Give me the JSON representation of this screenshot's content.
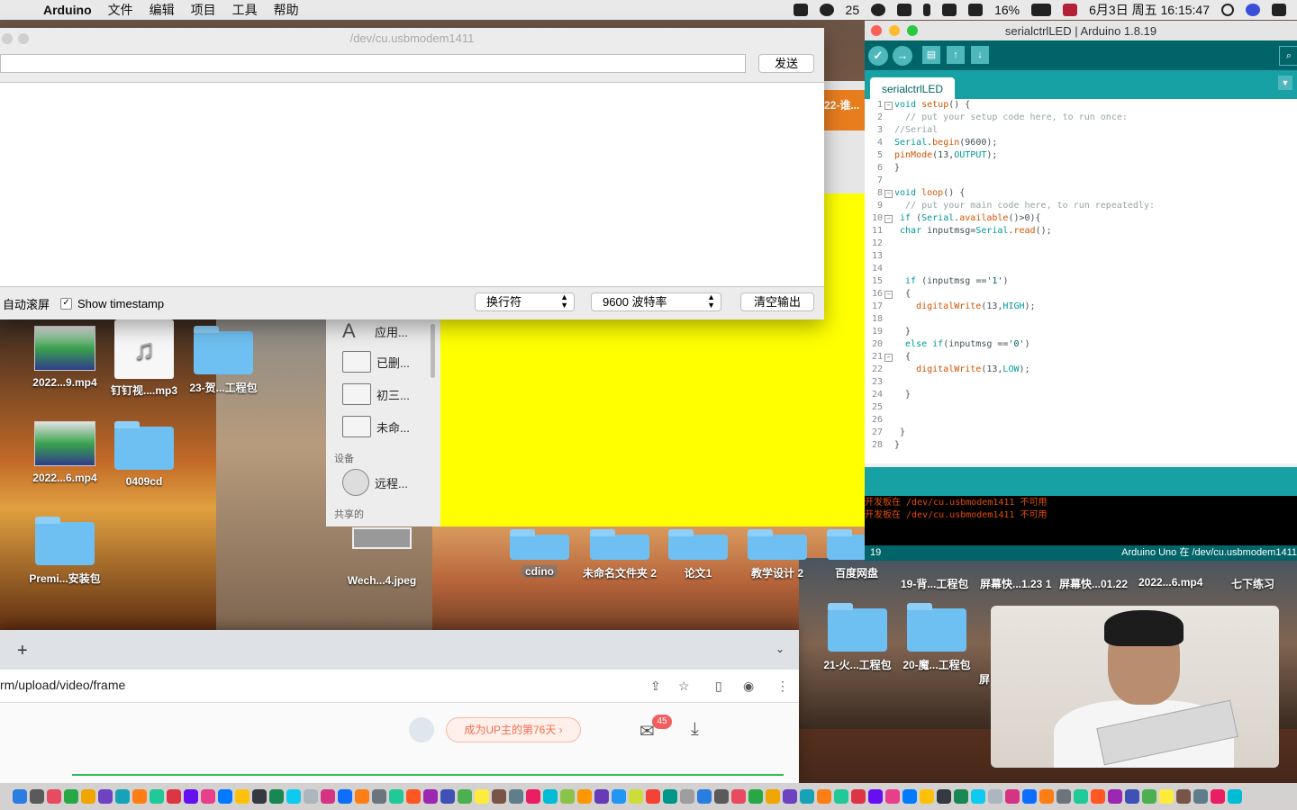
{
  "menubar": {
    "app_name": "Arduino",
    "menus": [
      "文件",
      "编辑",
      "项目",
      "工具",
      "帮助"
    ],
    "notification_count": "25",
    "battery": "16%",
    "datetime": "6月3日 周五  16:15:47"
  },
  "serial_monitor": {
    "title": "/dev/cu.usbmodem1411",
    "send_label": "发送",
    "autoscroll_label": "自动滚屏",
    "timestamp_checked": true,
    "timestamp_check_glyph": "✓",
    "timestamp_label": "Show timestamp",
    "line_ending": "换行符",
    "baud_rate": "9600 波特率",
    "clear_label": "清空输出",
    "select_arrow": "▲▼"
  },
  "ide": {
    "title": "serialctrlLED | Arduino 1.8.19",
    "tab_name": "serialctrlLED",
    "toolbar": {
      "verify": "✓",
      "upload": "→",
      "new": "▤",
      "open": "↑",
      "save": "↓",
      "serial": "⌕",
      "tab_menu": "▼"
    },
    "code_lines": [
      {
        "n": "1",
        "fold": "−"
      },
      {
        "n": "2"
      },
      {
        "n": "3"
      },
      {
        "n": "4"
      },
      {
        "n": "5"
      },
      {
        "n": "6"
      },
      {
        "n": "7"
      },
      {
        "n": "8",
        "fold": "−"
      },
      {
        "n": "9"
      },
      {
        "n": "10",
        "fold": "−"
      },
      {
        "n": "11"
      },
      {
        "n": "12"
      },
      {
        "n": "13"
      },
      {
        "n": "14"
      },
      {
        "n": "15"
      },
      {
        "n": "16",
        "fold": "−"
      },
      {
        "n": "17"
      },
      {
        "n": "18"
      },
      {
        "n": "19"
      },
      {
        "n": "20"
      },
      {
        "n": "21",
        "fold": "−"
      },
      {
        "n": "22"
      },
      {
        "n": "23"
      },
      {
        "n": "24"
      },
      {
        "n": "25"
      },
      {
        "n": "26"
      },
      {
        "n": "27"
      },
      {
        "n": "28"
      }
    ],
    "code": {
      "l1a": "void",
      "l1b": "setup",
      "l1c": "() {",
      "l2": "  // put your setup code here, to run once:",
      "l3": "//Serial",
      "l4a": "Serial",
      "l4b": ".",
      "l4c": "begin",
      "l4d": "(9600);",
      "l5a": "pinMode",
      "l5b": "(13,",
      "l5c": "OUTPUT",
      "l5d": ");",
      "l6": "}",
      "l8a": "void",
      "l8b": "loop",
      "l8c": "() {",
      "l9": "  // put your main code here, to run repeatedly:",
      "l10a": " if",
      "l10b": " (",
      "l10c": "Serial",
      "l10d": ".",
      "l10e": "available",
      "l10f": "()>0){",
      "l11a": " char",
      "l11b": " inputmsg=",
      "l11c": "Serial",
      "l11d": ".",
      "l11e": "read",
      "l11f": "();",
      "l15a": "  if",
      "l15b": " (inputmsg ==",
      "l15c": "'1'",
      "l15d": ")",
      "l16": "  {",
      "l17a": "    digitalWrite",
      "l17b": "(13,",
      "l17c": "HIGH",
      "l17d": ");",
      "l19": "  }",
      "l20a": "  else",
      "l20b": " if",
      "l20c": "(inputmsg ==",
      "l20d": "'0'",
      "l20e": ")",
      "l21": "  {",
      "l22a": "    digitalWrite",
      "l22b": "(13,",
      "l22c": "LOW",
      "l22d": ");",
      "l24": "  }",
      "l27": " }",
      "l28": "}"
    },
    "console": [
      "开发板在 /dev/cu.usbmodem1411 不可用",
      "开发板在 /dev/cu.usbmodem1411 不可用"
    ],
    "cursor_line": "19",
    "board_status": "Arduino Uno 在 /dev/cu.usbmodem1411"
  },
  "finder": {
    "items": [
      "应用...",
      "已删...",
      "初三...",
      "未命..."
    ],
    "devices_header": "设备",
    "device_item": "远程...",
    "shared_header": "共享的"
  },
  "desktop": {
    "orange_label": "22-谁...",
    "icons": {
      "video1": "2022...9.mp4",
      "music": "钉钉视....mp3",
      "folder23": "23-贺...工程包",
      "video2": "2022...6.mp4",
      "folder0409": "0409cd",
      "premi": "Premi...安装包",
      "wech": "Wech...4.jpeg",
      "cdino": "cdino",
      "unnamed2": "未命名文件夹 2",
      "lunwen": "论文1",
      "jiaoxue": "教学设计 2",
      "baidu": "百度网盘",
      "folder19": "19-背...工程包",
      "screen1": "屏幕快...1.23 1",
      "screen2": "屏幕快...01.22",
      "video3": "2022...6.mp4",
      "qixia": "七下练习",
      "folder21": "21-火...工程包",
      "folder20": "20-魔...工程包",
      "screen3": "屏"
    }
  },
  "browser": {
    "new_tab": "+",
    "tab_dropdown": "⌄",
    "url": "rm/upload/video/frame",
    "up_text": "成为UP主的第76天  ›",
    "mail_badge": "45",
    "icons": {
      "share": "⇪",
      "star": "☆",
      "sidebar": "▯",
      "profile": "◉",
      "more": "⋮",
      "mail": "✉",
      "download": "⤓"
    }
  },
  "colors": {
    "arduino_teal_dark": "#006468",
    "arduino_teal": "#17a1a5",
    "console_error": "#e34c00",
    "yellow": "#ffff00",
    "progress_green": "#2ebd59"
  }
}
